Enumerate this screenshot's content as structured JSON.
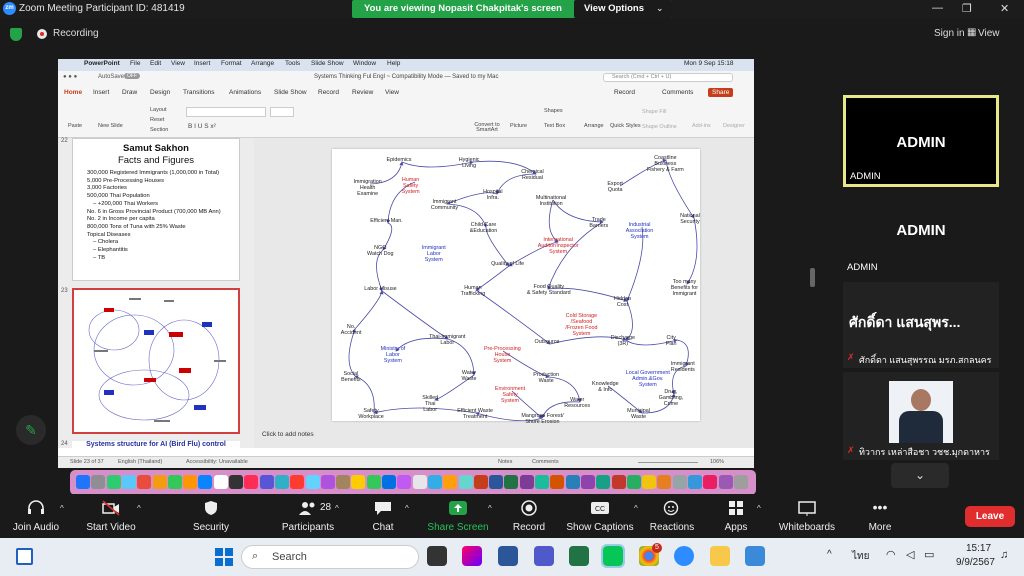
{
  "window": {
    "title": "Zoom Meeting Participant ID: 481419",
    "logo_text": "zm"
  },
  "banner": {
    "text": "You are viewing Nopasit Chakpitak's screen",
    "view_options": "View Options"
  },
  "topbar": {
    "recording": "Recording",
    "sign_in": "Sign in",
    "view": "View"
  },
  "mac": {
    "menu": [
      "PowerPoint",
      "File",
      "Edit",
      "View",
      "Insert",
      "Format",
      "Arrange",
      "Tools",
      "Slide Show",
      "Window",
      "Help"
    ],
    "clock": "Mon 9 Sep  15:18",
    "doc_title": "Systems Thinking Ful Engl ~ Compatibility Mode — Saved to my Mac",
    "autosave": "AutoSave",
    "autosave_state": "OFF",
    "search_placeholder": "Search (Cmd + Ctrl + U)"
  },
  "ribbon": {
    "tabs": [
      "Home",
      "Insert",
      "Draw",
      "Design",
      "Transitions",
      "Animations",
      "Slide Show",
      "Record",
      "Review",
      "View"
    ],
    "record": "Record",
    "comments": "Comments",
    "share": "Share",
    "buttons": [
      "Paste",
      "New Slide",
      "Layout",
      "Reset",
      "Section",
      "Convert to SmartArt",
      "Picture",
      "Shapes",
      "Text Box",
      "Arrange",
      "Quick Styles",
      "Shape Fill",
      "Shape Outline",
      "Add-ins",
      "Designer"
    ]
  },
  "thumbs": {
    "n22": "22",
    "n23": "23",
    "n24": "24",
    "s22_title": "Samut Sakhon",
    "s22_subtitle": "Facts and Figures",
    "s22_bullets": [
      "300,000 Registered Immigrants (1,000,000 in Total)",
      "5,000 Pre-Processing Houses",
      "3,000 Factories",
      "500,000 Thai Population",
      "  – +200,000 Thai Workers",
      "No. 6 in Gross Provincial Product (700,000 MB Ann)",
      "No. 2 in Income per capita",
      "800,000 Tons of Tuna with 25% Waste",
      "Topical Diseases",
      "  – Cholera",
      "  – Elephantitis",
      "  – TB"
    ],
    "s24_title": "Systems structure for AI (Bird Flu) control"
  },
  "diagram": {
    "nodes": [
      {
        "t": "Epidemics",
        "c": ""
      },
      {
        "t": "Hygienic\nLiving",
        "c": ""
      },
      {
        "t": "Chemical\nResidual",
        "c": ""
      },
      {
        "t": "Coastline\nBusiness\nFishery & Farm",
        "c": ""
      },
      {
        "t": "Immigration\nHealth\nExamine",
        "c": ""
      },
      {
        "t": "Human\nSafety\nSystem",
        "c": "red"
      },
      {
        "t": "Hospital\nInfra.",
        "c": ""
      },
      {
        "t": "Export\nQuota",
        "c": ""
      },
      {
        "t": "Immigrant\nCommunity",
        "c": ""
      },
      {
        "t": "Multinational\nInstitution",
        "c": ""
      },
      {
        "t": "National\nSecurity",
        "c": ""
      },
      {
        "t": "Efficient Man.",
        "c": ""
      },
      {
        "t": "Child Care\n&Education",
        "c": ""
      },
      {
        "t": "Trade\nBarriers",
        "c": ""
      },
      {
        "t": "Industrial\nAssociation\nSystem",
        "c": "blue"
      },
      {
        "t": "International\nAuditor/Inspector\nSystem",
        "c": "red"
      },
      {
        "t": "NGO\nWatch Dog",
        "c": ""
      },
      {
        "t": "Immigrant\nLabor\nSystem",
        "c": "blue"
      },
      {
        "t": "Quality of Life",
        "c": ""
      },
      {
        "t": "Too many\nBenefits for\nImmigrant",
        "c": ""
      },
      {
        "t": "Labor Misuse",
        "c": ""
      },
      {
        "t": "Human\nTrafficking",
        "c": ""
      },
      {
        "t": "Food Quality\n& Safety Standard",
        "c": ""
      },
      {
        "t": "Hidden\nCost",
        "c": ""
      },
      {
        "t": "No.\nAccident",
        "c": ""
      },
      {
        "t": "Cold Storage\n/Seafood\n/Frozen Food\nSystem",
        "c": "red"
      },
      {
        "t": "Thai-Immigrant\nLabor",
        "c": ""
      },
      {
        "t": "Outsource",
        "c": ""
      },
      {
        "t": "Discharge\n(3R)",
        "c": ""
      },
      {
        "t": "City\nPlan",
        "c": ""
      },
      {
        "t": "Ministry of\nLabor\nSystem",
        "c": "blue"
      },
      {
        "t": "Pre-Processing\nHouse\nSystem",
        "c": "red"
      },
      {
        "t": "Local Government\nAdmin.&Gov.\nSystem",
        "c": "blue"
      },
      {
        "t": "Immigrant\nResidents",
        "c": ""
      },
      {
        "t": "Social\nBenefits",
        "c": ""
      },
      {
        "t": "Water\nWaste",
        "c": ""
      },
      {
        "t": "Production\nWaste",
        "c": ""
      },
      {
        "t": "Knowledge\n& Info",
        "c": ""
      },
      {
        "t": "Environment\nSafety\nSystem",
        "c": "red"
      },
      {
        "t": "Drug,\nGambling,\nCrime",
        "c": ""
      },
      {
        "t": "Skilled\nThai\nLabor",
        "c": ""
      },
      {
        "t": "Water\nResources",
        "c": ""
      },
      {
        "t": "Safety\nWorkplace",
        "c": ""
      },
      {
        "t": "Efficient Waste\nTreatment",
        "c": ""
      },
      {
        "t": "Mangrove Forest/\nShore Erosion",
        "c": ""
      },
      {
        "t": "Municipal\nWaste",
        "c": ""
      }
    ]
  },
  "editor": {
    "notes": "Click to add notes"
  },
  "status": {
    "slide": "Slide 23 of 37",
    "lang": "English (Thailand)",
    "access": "Accessibility: Unavailable",
    "notes": "Notes",
    "comments": "Comments",
    "zoom": "106%"
  },
  "participants": [
    {
      "big": "ADMIN",
      "name": "ADMIN"
    },
    {
      "big": "ADMIN",
      "name": "ADMIN"
    },
    {
      "big": "ศักดิ์ดา แสนสุพร...",
      "name": "ศักดิ์ดา แสนสุพรรณ มรภ.สกลนคร"
    },
    {
      "big": "",
      "name": "ทิวากร เหล่าสือชา วชช.มุกดาหาร"
    }
  ],
  "toolbar": {
    "join_audio": "Join Audio",
    "start_video": "Start Video",
    "security": "Security",
    "participants": "Participants",
    "participants_count": "28",
    "chat": "Chat",
    "share_screen": "Share Screen",
    "record": "Record",
    "captions": "Show Captions",
    "reactions": "Reactions",
    "apps": "Apps",
    "whiteboards": "Whiteboards",
    "more": "More",
    "leave": "Leave"
  },
  "taskbar": {
    "search": "Search",
    "lang": "ไทย",
    "time": "15:17",
    "date": "9/9/2567",
    "badge": "5"
  },
  "colors": {
    "zoom_green": "#23a247",
    "leave_red": "#e02d2d",
    "tile_highlight": "#e8e88a",
    "ppt_accent": "#c43e1c"
  }
}
